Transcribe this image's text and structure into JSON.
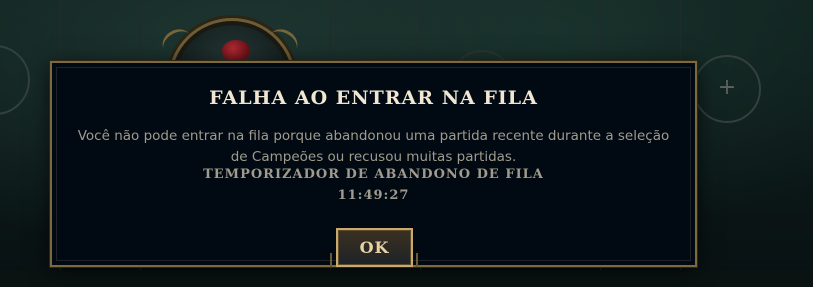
{
  "background": {
    "add_slot_glyph": "+"
  },
  "dialog": {
    "title": "FALHA AO ENTRAR NA FILA",
    "message_line1": "Você não pode entrar na fila porque abandonou uma partida recente durante a seleção",
    "message_line2": "de Campeões ou recusou muitas partidas.",
    "timer_label": "TEMPORIZADOR DE ABANDONO DE FILA",
    "timer_value": "11:49:27",
    "ok_label": "OK"
  },
  "colors": {
    "dialog_bg": "#010a13",
    "gold_border": "#c8aa6e",
    "title_text": "#f0e6d2",
    "body_text": "#a09b8c"
  }
}
